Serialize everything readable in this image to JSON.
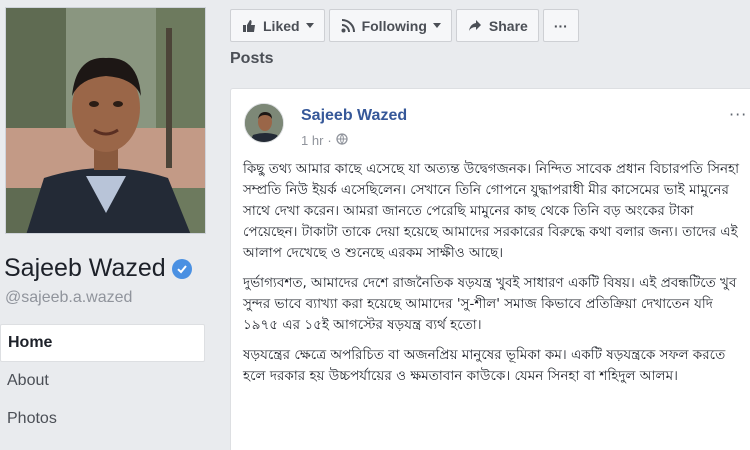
{
  "profile": {
    "name": "Sajeeb Wazed",
    "handle": "@sajeeb.a.wazed"
  },
  "nav": {
    "items": [
      {
        "label": "Home",
        "active": true
      },
      {
        "label": "About",
        "active": false
      },
      {
        "label": "Photos",
        "active": false
      }
    ]
  },
  "actions": {
    "liked_label": "Liked",
    "following_label": "Following",
    "share_label": "Share",
    "more_label": "···"
  },
  "posts_heading": "Posts",
  "post": {
    "author": "Sajeeb Wazed",
    "time": "1 hr",
    "time_separator": "·",
    "more": "···",
    "paragraphs": [
      "কিছু তথ্য আমার কাছে এসেছে যা অত্যন্ত উদ্বেগজনক। নিন্দিত সাবেক প্রধান বিচারপতি সিনহা সম্প্রতি নিউ ইয়র্ক এসেছিলেন। সেখানে তিনি গোপনে যুদ্ধাপরাধী মীর কাসেমের ভাই মামুনের সাথে দেখা করেন। আমরা জানতে পেরেছি মামুনের কাছ থেকে তিনি বড় অংকের টাকা পেয়েছেন। টাকাটা তাকে দেয়া হয়েছে আমাদের সরকারের বিরুদ্ধে কথা বলার জন্য। তাদের এই আলাপ দেখেছে ও শুনেছে এরকম সাক্ষীও আছে।",
      "দুর্ভাগ্যবশত, আমাদের দেশে রাজনৈতিক ষড়যন্ত্র খুবই সাধারণ একটি বিষয়। এই প্রবন্ধটিতে খুব সুন্দর ভাবে ব্যাখ্যা করা হয়েছে আমাদের 'সু-শীল' সমাজ কিভাবে প্রতিক্রিয়া দেখাতেন যদি ১৯৭৫ এর ১৫ই আগস্টের ষড়যন্ত্র ব্যর্থ হতো।",
      "ষড়যন্ত্রের ক্ষেত্রে অপরিচিত বা অজনপ্রিয় মানুষের ভূমিকা কম। একটি ষড়যন্ত্রকে সফল করতে হলে দরকার হয় উচ্চপর্যায়ের ও ক্ষমতাবান কাউকে। যেমন সিনহা বা শহিদুল আলম।"
    ]
  },
  "colors": {
    "link": "#365899",
    "verified": "#4a90e2",
    "background": "#e9ebee"
  },
  "icons": [
    "thumbs-up-icon",
    "rss-icon",
    "share-arrow-icon",
    "globe-icon",
    "verified-badge-icon"
  ]
}
